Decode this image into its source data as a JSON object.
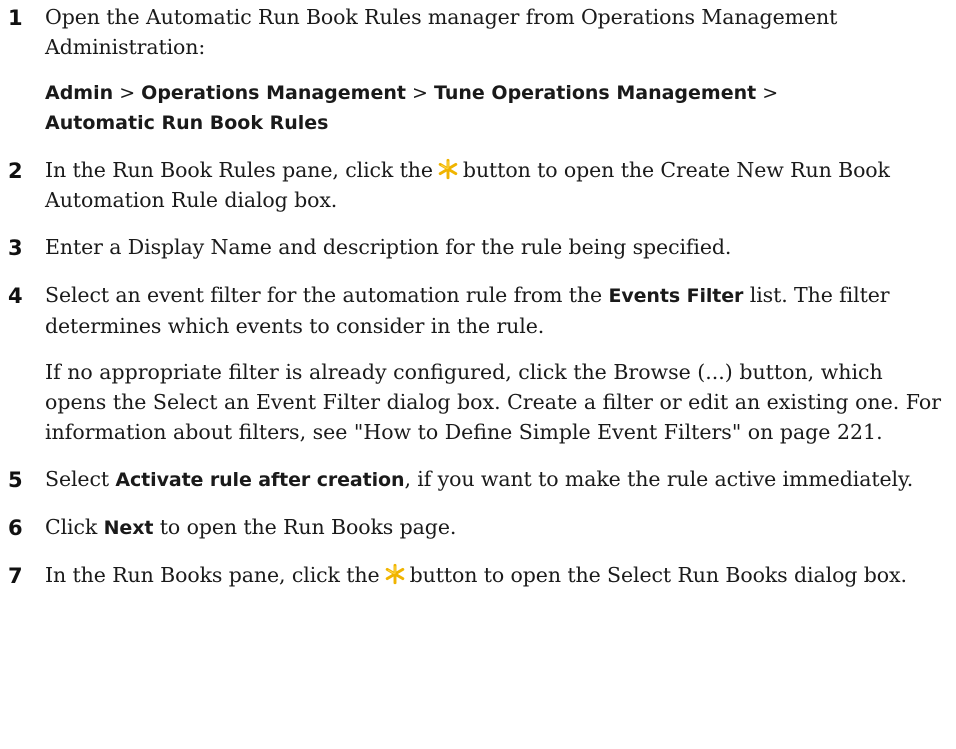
{
  "steps": [
    {
      "num": "1",
      "text": "Open the Automatic Run Book Rules manager from Operations Management Administration:"
    },
    {
      "num": "2",
      "before": "In the Run Book Rules pane, click the",
      "icon": "new-star-icon",
      "after": "button to open the Create New Run Book Automation Rule dialog box."
    },
    {
      "num": "3",
      "text": "Enter a Display Name and description for the rule being specified."
    },
    {
      "num": "4",
      "before": "Select an event filter for the automation rule from the",
      "bold": "Events Filter",
      "after": "list. The filter determines which events to consider in the rule.",
      "paragraph": "If no appropriate filter is already configured, click the Browse (...) button, which opens the Select an Event Filter dialog box. Create a filter or edit an existing one. For information about filters, see \"How to Define Simple Event Filters\" on page 221."
    },
    {
      "num": "5",
      "before": "Select",
      "bold": "Activate rule after creation",
      "after": ", if you want to make the rule active immediately."
    },
    {
      "num": "6",
      "before": "Click",
      "bold": "Next",
      "after": "to open the Run Books page."
    },
    {
      "num": "7",
      "before": "In the Run Books pane, click the",
      "icon": "new-star-icon",
      "after": "button to open the Select Run Books dialog box."
    }
  ],
  "nav_path": {
    "items": [
      "Admin",
      "Operations Management",
      "Tune Operations Management",
      "Automatic Run Book Rules"
    ],
    "separator": ">"
  },
  "colors": {
    "text": "#1a1a1a",
    "star": "#f0b400"
  }
}
